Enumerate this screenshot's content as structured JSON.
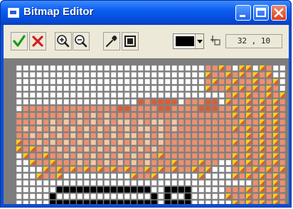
{
  "window": {
    "title": "Bitmap Editor"
  },
  "title_buttons": {
    "minimize": "minimize",
    "maximize": "maximize",
    "close": "close"
  },
  "toolbar": {
    "tools": [
      "check-icon",
      "cross-icon",
      "zoom-in-icon",
      "zoom-out-icon",
      "eyedropper-icon",
      "select-frame-icon"
    ],
    "color": "#000000",
    "coordinates": "32 , 10"
  },
  "bitmap": {
    "palette": {
      "empty": "#ffffff",
      "black": "#000000",
      "light": "#f6c7a4",
      "mid": "#f08f6c",
      "dark": "#e05a30",
      "yellow": "#f5d21a",
      "grid": "#8a8a8a"
    },
    "columns": 40,
    "rows": 22,
    "pixels": [
      "............................oMYM.YY.Yo..",
      "............................YMMYMYMYMY..",
      "............................MYMMYMMYMMY.",
      "............................YMMYMYMYMYM.",
      "...............................MYMYMMYMY",
      "..................DMDDDD.MMMDD.YMMYMYMYM",
      ".ooMMMMMMMMMMMMDDMMMMDDMMMMDDDMMYMYMYMYM",
      "oooMMMMLMLMLMLMMMMMMMMMMMMMMMMMMYMYMYMYM",
      "MMMLMLMLMLMLMLMLLMLMLLMLMMMMMMMMMYMMYMYM",
      "MLMLMLLMLMLMLMLMLMLLMLMLMMMMMMMMYMYMYMYM",
      "MMLMLMLMLMLMLMLMLLMLMLMMMMMMMMMMMMYMYMYM",
      "YMMLMLMLMLMLMLMLMLMLMLMMMMMMMMMMYMYMYMYM",
      "YMYMLMLMLMLMLMLMLMLMLMMMMMMMMMMMMMYMYMYM",
      ".YMMYMMLMLMLMLMLMLMLMYMMMMMMMMMMYMYMYMYM",
      "..YMMYMMMLMLMLMLMLMLMMMYMMMYMM..YMYMYMYM",
      "....YMYMYMYMYMYMYMMYMYMYMMYMY...MYMYMYMY",
      "...YMMY..........YMMY......Y....YMYMYMYM",
      "...................................MYMYM",
      "......BBBBBBBBBBBBBB..BBBB.....MMMYMYMYM",
      ".....B..............B.B..B.....YMMYMYMYM",
      ".....BBBBBBBBBBBBBBBB.BBBB......YMYMYMYM",
      "...................................YMYMY"
    ]
  }
}
